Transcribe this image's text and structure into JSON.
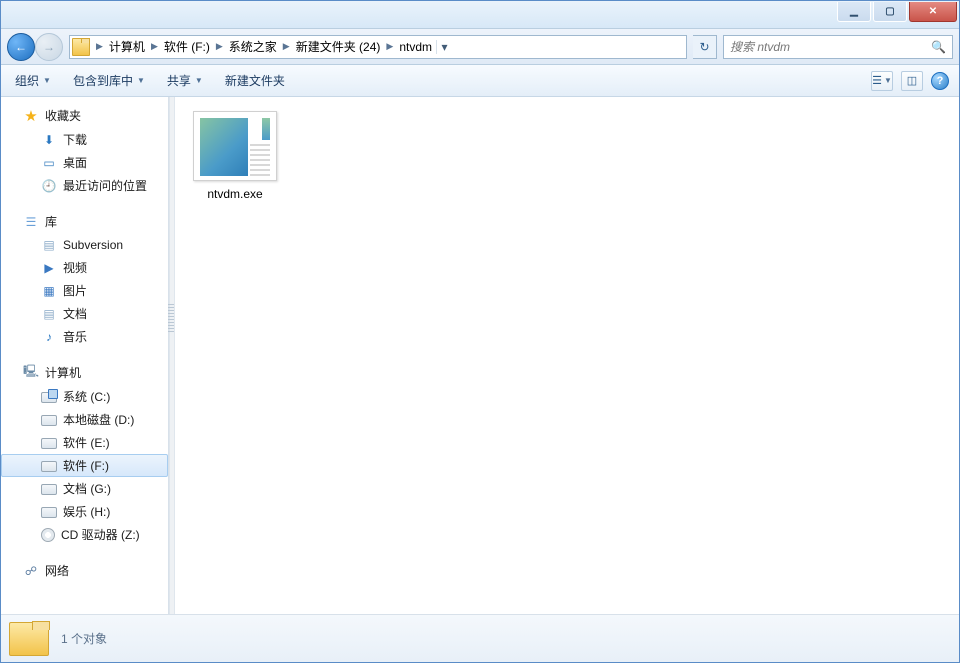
{
  "window": {
    "minimize_glyph": "▁",
    "maximize_glyph": "▢",
    "close_glyph": "✕"
  },
  "nav": {
    "back_glyph": "←",
    "forward_glyph": "→",
    "breadcrumbs": [
      "计算机",
      "软件 (F:)",
      "系统之家",
      "新建文件夹 (24)",
      "ntvdm"
    ],
    "refresh_glyph": "↻",
    "search_placeholder": "搜索 ntvdm",
    "search_icon": "🔍"
  },
  "toolbar": {
    "organize": "组织",
    "include": "包含到库中",
    "share": "共享",
    "newfolder": "新建文件夹"
  },
  "navpane": {
    "favorites": {
      "head": "收藏夹",
      "items": [
        "下载",
        "桌面",
        "最近访问的位置"
      ]
    },
    "libraries": {
      "head": "库",
      "items": [
        "Subversion",
        "视频",
        "图片",
        "文档",
        "音乐"
      ]
    },
    "computer": {
      "head": "计算机",
      "items": [
        "系统 (C:)",
        "本地磁盘 (D:)",
        "软件 (E:)",
        "软件 (F:)",
        "文档 (G:)",
        "娱乐 (H:)",
        "CD 驱动器 (Z:)"
      ]
    },
    "network": {
      "head": "网络"
    }
  },
  "content": {
    "items": [
      {
        "name": "ntvdm.exe"
      }
    ]
  },
  "status": {
    "text": "1 个对象"
  }
}
